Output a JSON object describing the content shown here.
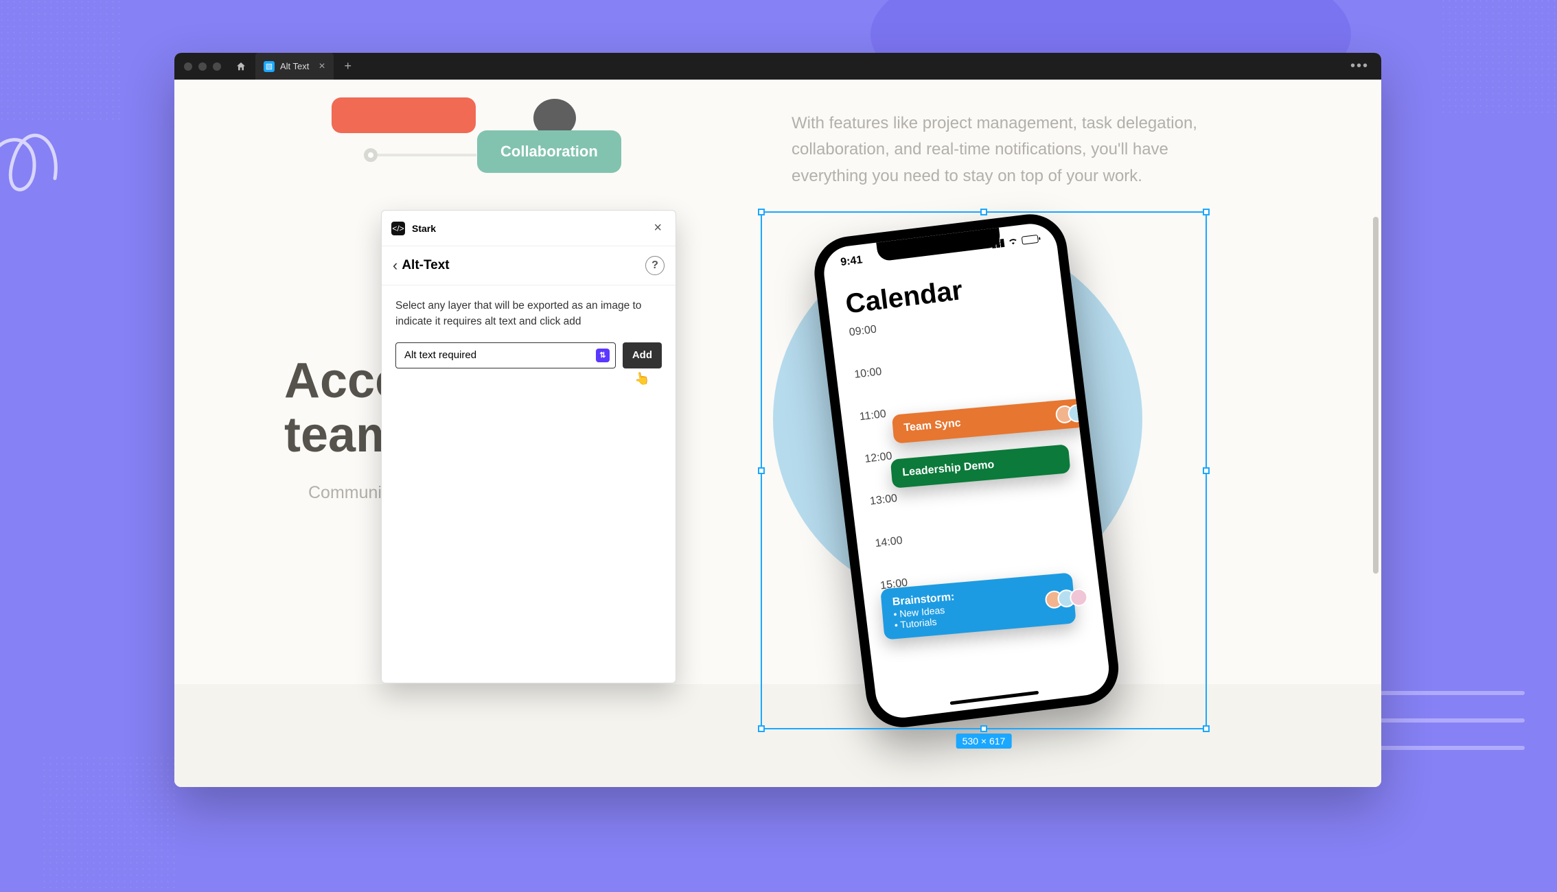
{
  "titlebar": {
    "tab_name": "Alt Text"
  },
  "canvas": {
    "paragraph_right": "With features like project management, task delegation, collaboration, and real-time notifications, you'll have everything you need to stay on top of your work.",
    "headline_line1": "Acce",
    "headline_line2": "team",
    "subtext": "Communicat                                      ugh our chat, vid                                     one up-to-date a",
    "collab_pill": "Collaboration"
  },
  "selection": {
    "size_badge": "530 × 617"
  },
  "phone": {
    "time": "9:41",
    "title": "Calendar",
    "times": [
      "09:00",
      "10:00",
      "11:00",
      "12:00",
      "13:00",
      "14:00",
      "15:00"
    ],
    "events": {
      "orange": "Team Sync",
      "green": "Leadership Demo",
      "blue_title": "Brainstorm:",
      "blue_line1": "• New Ideas",
      "blue_line2": "• Tutorials"
    }
  },
  "plugin": {
    "app_name": "Stark",
    "section_title": "Alt-Text",
    "instruction": "Select any layer that will be exported as an image to indicate it requires alt text and click add",
    "select_value": "Alt text required",
    "add_label": "Add"
  }
}
